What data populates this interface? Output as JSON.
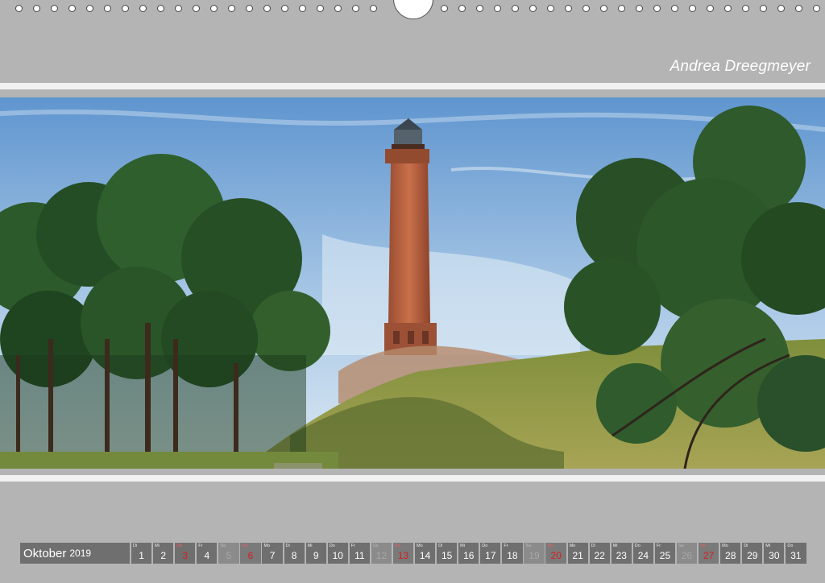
{
  "author": "Andrea Dreegmeyer",
  "calendar": {
    "month": "Oktober",
    "year": "2019",
    "days": [
      {
        "wd": "Di",
        "d": "1",
        "type": "work"
      },
      {
        "wd": "Mi",
        "d": "2",
        "type": "work"
      },
      {
        "wd": "Do",
        "d": "3",
        "type": "hol"
      },
      {
        "wd": "Fr",
        "d": "4",
        "type": "work"
      },
      {
        "wd": "Sa",
        "d": "5",
        "type": "sat"
      },
      {
        "wd": "So",
        "d": "6",
        "type": "sun"
      },
      {
        "wd": "Mo",
        "d": "7",
        "type": "work"
      },
      {
        "wd": "Di",
        "d": "8",
        "type": "work"
      },
      {
        "wd": "Mi",
        "d": "9",
        "type": "work"
      },
      {
        "wd": "Do",
        "d": "10",
        "type": "work"
      },
      {
        "wd": "Fr",
        "d": "11",
        "type": "work"
      },
      {
        "wd": "Sa",
        "d": "12",
        "type": "sat"
      },
      {
        "wd": "So",
        "d": "13",
        "type": "sun"
      },
      {
        "wd": "Mo",
        "d": "14",
        "type": "work"
      },
      {
        "wd": "Di",
        "d": "15",
        "type": "work"
      },
      {
        "wd": "Mi",
        "d": "16",
        "type": "work"
      },
      {
        "wd": "Do",
        "d": "17",
        "type": "work"
      },
      {
        "wd": "Fr",
        "d": "18",
        "type": "work"
      },
      {
        "wd": "Sa",
        "d": "19",
        "type": "sat"
      },
      {
        "wd": "So",
        "d": "20",
        "type": "sun"
      },
      {
        "wd": "Mo",
        "d": "21",
        "type": "work"
      },
      {
        "wd": "Di",
        "d": "22",
        "type": "work"
      },
      {
        "wd": "Mi",
        "d": "23",
        "type": "work"
      },
      {
        "wd": "Do",
        "d": "24",
        "type": "work"
      },
      {
        "wd": "Fr",
        "d": "25",
        "type": "work"
      },
      {
        "wd": "Sa",
        "d": "26",
        "type": "sat"
      },
      {
        "wd": "So",
        "d": "27",
        "type": "sun"
      },
      {
        "wd": "Mo",
        "d": "28",
        "type": "work"
      },
      {
        "wd": "Di",
        "d": "29",
        "type": "work"
      },
      {
        "wd": "Mi",
        "d": "30",
        "type": "work"
      },
      {
        "wd": "Do",
        "d": "31",
        "type": "work"
      }
    ]
  },
  "colors": {
    "page": "#b4b4b4",
    "band": "#f2f2f2",
    "cell": "#6f6f6f",
    "holiday": "#d61f1f"
  }
}
